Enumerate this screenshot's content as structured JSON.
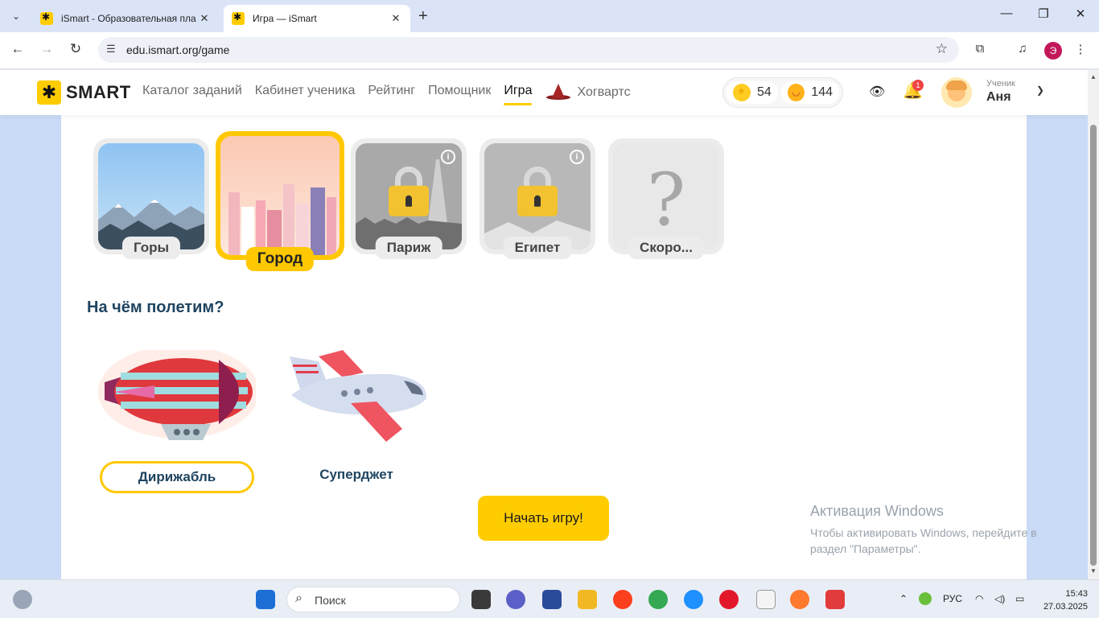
{
  "browser": {
    "tabs": [
      {
        "title": "iSmart - Образовательная пла",
        "active": false
      },
      {
        "title": "Игра — iSmart",
        "active": true
      }
    ],
    "url": "edu.ismart.org/game",
    "profile_initial": "Э"
  },
  "site": {
    "logo": "SMART",
    "nav": [
      {
        "label": "Каталог заданий",
        "active": false
      },
      {
        "label": "Кабинет ученика",
        "active": false
      },
      {
        "label": "Рейтинг",
        "active": false
      },
      {
        "label": "Помощник",
        "active": false
      },
      {
        "label": "Игра",
        "active": true
      },
      {
        "label": "Хогвартс",
        "active": false
      }
    ],
    "coins": "54",
    "smiles": "144",
    "notifications": "1",
    "user": {
      "role": "Ученик",
      "name": "Аня"
    }
  },
  "locations": [
    {
      "label": "Горы",
      "state": "available"
    },
    {
      "label": "Город",
      "state": "selected"
    },
    {
      "label": "Париж",
      "state": "locked"
    },
    {
      "label": "Египет",
      "state": "locked"
    },
    {
      "label": "Скоро...",
      "state": "soon"
    }
  ],
  "vehicles": {
    "title": "На чём полетим?",
    "items": [
      {
        "label": "Дирижабль",
        "selected": true
      },
      {
        "label": "Суперджет",
        "selected": false
      }
    ]
  },
  "start_button": "Начать игру!",
  "windows_activation": {
    "title": "Активация Windows",
    "text": "Чтобы активировать Windows, перейдите в раздел \"Параметры\"."
  },
  "taskbar": {
    "search_placeholder": "Поиск",
    "lang": "РУС",
    "time": "15:43",
    "date": "27.03.2025"
  },
  "colors": {
    "accent": "#ffcc00",
    "heading": "#1e4460",
    "background": "#c9dbf6"
  }
}
